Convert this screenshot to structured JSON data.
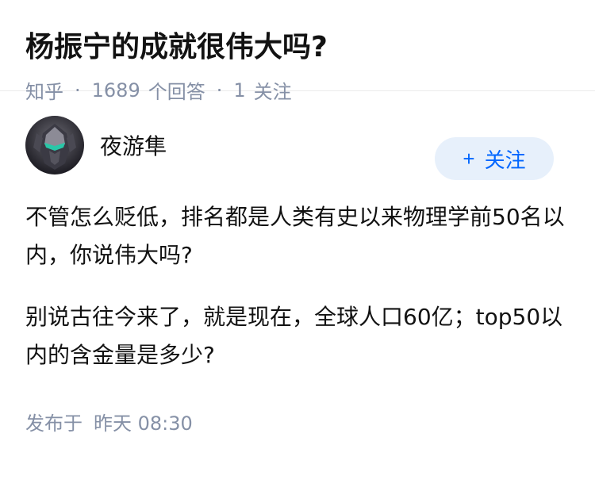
{
  "question": {
    "title": "杨振宁的成就很伟大吗?",
    "source": "知乎",
    "answer_count": "1689",
    "answer_label": "个回答",
    "follower_count": "1",
    "follower_label": "关注"
  },
  "answer": {
    "author_name": "夜游隼",
    "follow_button": "关注",
    "paragraphs": [
      "不管怎么贬低，排名都是人类有史以来物理学前50名以内，你说伟大吗?",
      "别说古往今来了，就是现在，全球人口60亿；top50以内的含金量是多少?"
    ],
    "publish_label": "发布于",
    "publish_time": "昨天 08:30"
  },
  "colors": {
    "accent": "#0066ff",
    "button_bg": "#e7f0fb",
    "meta_text": "#8590a6"
  }
}
